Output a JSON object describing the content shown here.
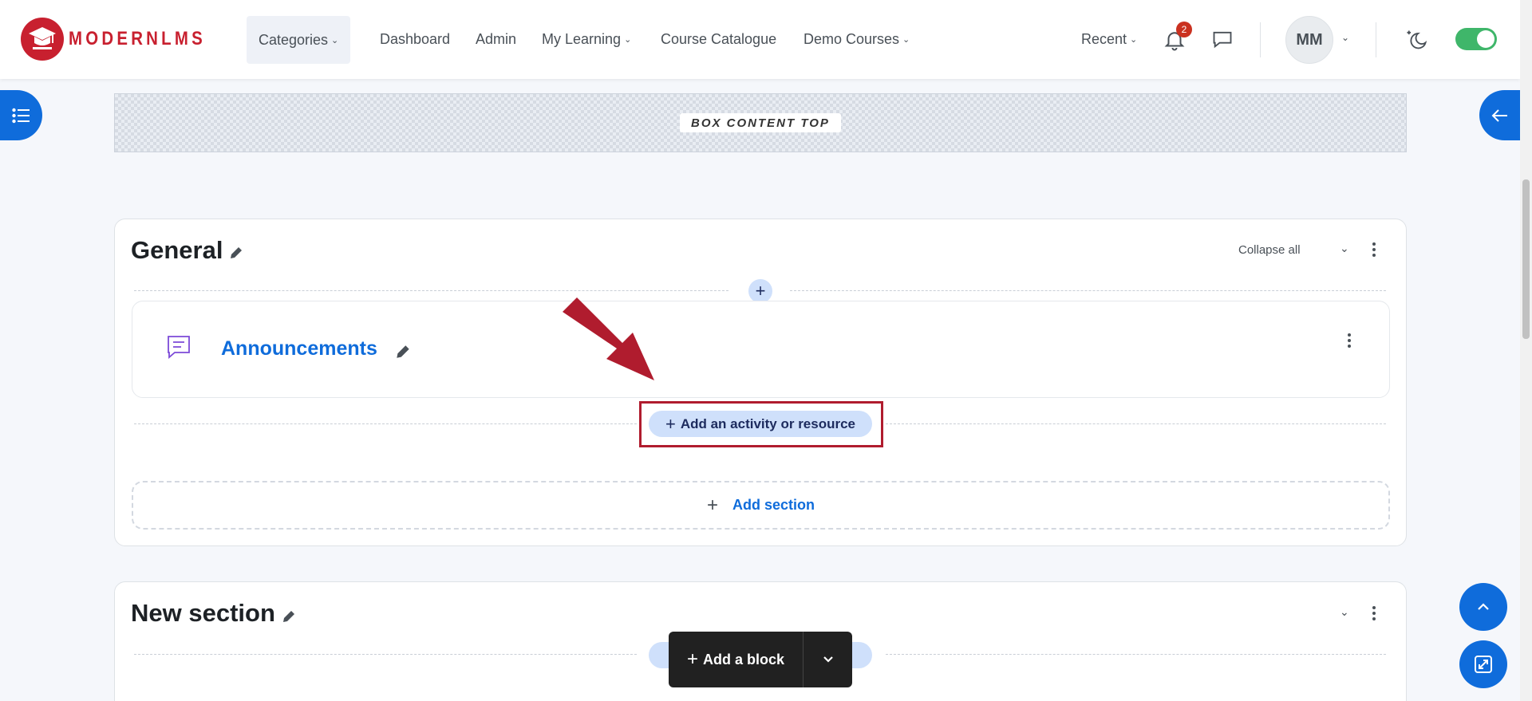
{
  "brand": {
    "logo_text": "MODERNLMS",
    "accent": "#c8202f",
    "primary": "#0f6cdb"
  },
  "nav": {
    "categories": "Categories",
    "dashboard": "Dashboard",
    "admin": "Admin",
    "my_learning": "My Learning",
    "course_catalogue": "Course Catalogue",
    "demo_courses": "Demo Courses",
    "recent": "Recent",
    "notification_count": "2",
    "avatar_initials": "MM"
  },
  "box_content_top": "BOX CONTENT TOP",
  "sections": [
    {
      "title": "General",
      "collapse_all": "Collapse all",
      "activities": [
        {
          "name": "Announcements",
          "icon": "forum-icon"
        }
      ],
      "add_activity": "Add an activity or resource",
      "add_section": "Add section"
    },
    {
      "title": "New section"
    }
  ],
  "add_block": {
    "label": "Add a block"
  },
  "icons": [
    "menu-icon",
    "bell-icon",
    "chat-icon",
    "moon-icon",
    "arrow-left-icon",
    "pencil-icon",
    "kebab-icon",
    "chevron-up-icon",
    "fullscreen-icon"
  ]
}
